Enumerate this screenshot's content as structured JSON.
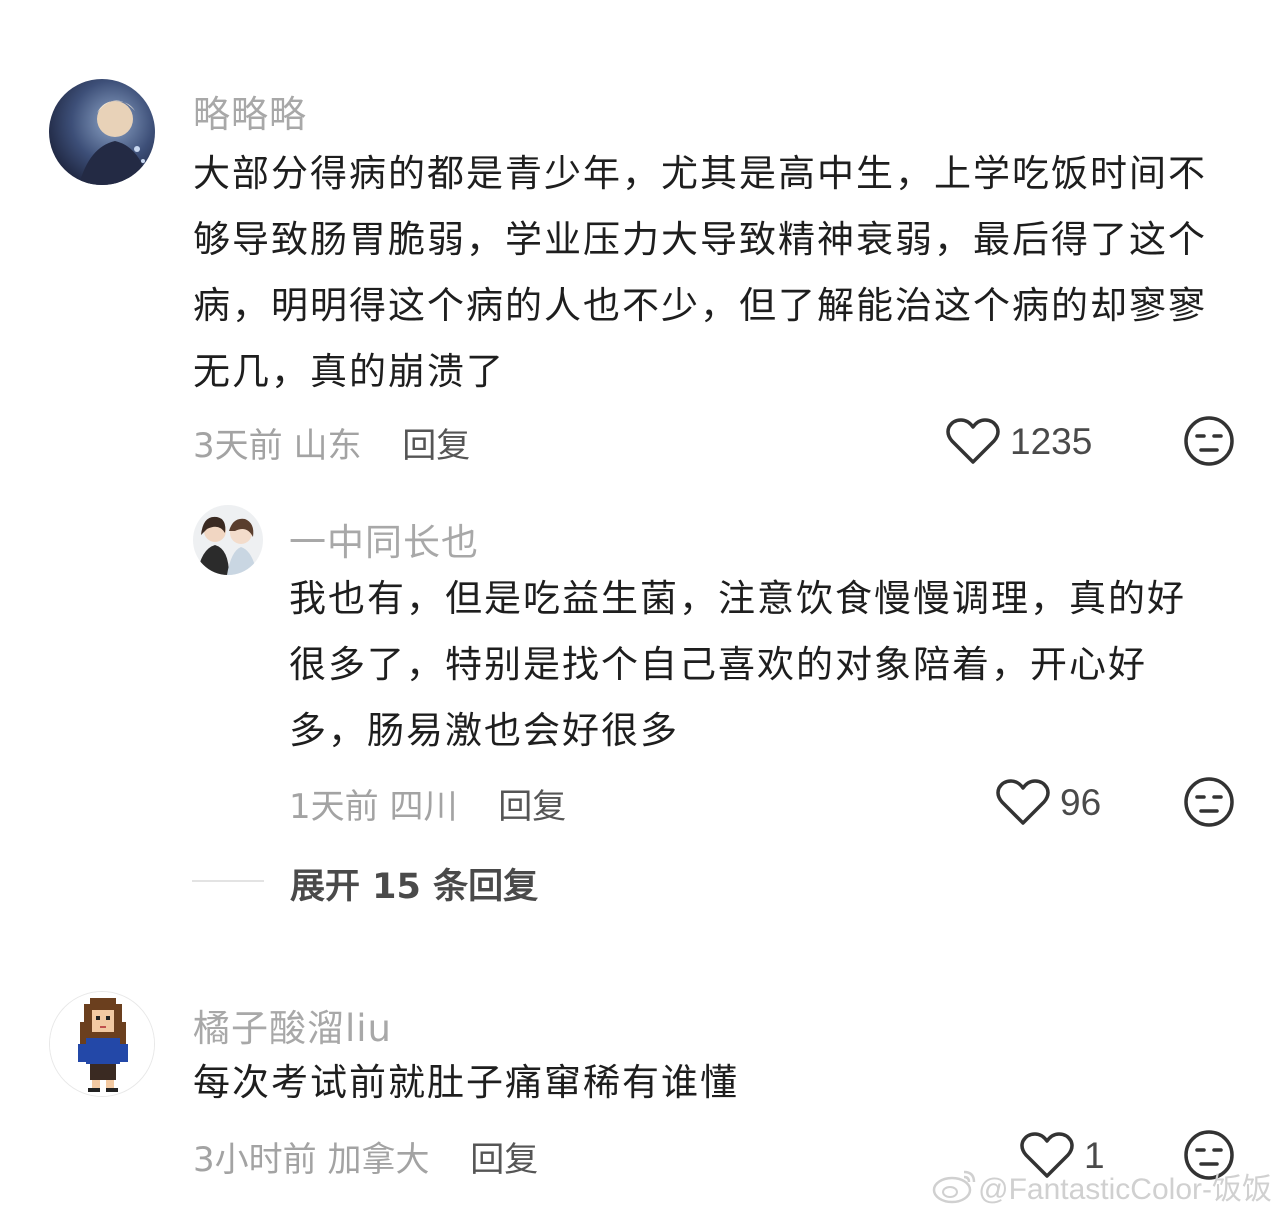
{
  "comments": [
    {
      "username": "略略略",
      "text": "大部分得病的都是青少年，尤其是高中生，上学吃饭时间不够导致肠胃脆弱，学业压力大导致精神衰弱，最后得了这个病，明明得这个病的人也不少，但了解能治这个病的却寥寥无几，真的崩溃了",
      "time": "3天前",
      "location": "山东",
      "reply_label": "回复",
      "likes": "1235"
    },
    {
      "username": "一中同长也",
      "text": "我也有，但是吃益生菌，注意饮食慢慢调理，真的好很多了，特别是找个自己喜欢的对象陪着，开心好多，肠易激也会好很多",
      "time": "1天前",
      "location": "四川",
      "reply_label": "回复",
      "likes": "96"
    },
    {
      "username": "橘子酸溜liu",
      "text": "每次考试前就肚子痛窜稀有谁懂",
      "time": "3小时前",
      "location": "加拿大",
      "reply_label": "回复",
      "likes": "1"
    }
  ],
  "expand_replies": "展开 15 条回复",
  "watermark": "@FantasticColor-饭饭",
  "icons": {
    "like": "heart-outline-icon",
    "reaction": "neutral-face-icon",
    "watermark_logo": "weibo-logo-icon"
  },
  "colors": {
    "username": "#a8a8a8",
    "text": "#1e1e1e",
    "meta": "#a3a3a3",
    "reply": "#555555"
  }
}
